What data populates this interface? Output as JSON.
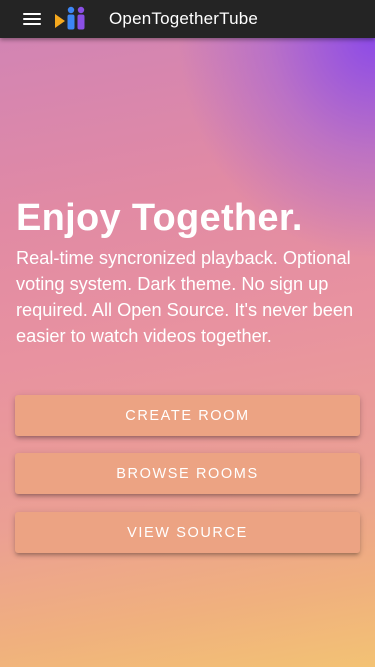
{
  "app_bar": {
    "title": "OpenTogetherTube",
    "menu_icon": "hamburger-menu-icon",
    "logo_icon": "opentogethertube-logo"
  },
  "hero": {
    "title": "Enjoy Together.",
    "subtitle": "Real-time syncronized playback. Optional voting system. Dark theme. No sign up required. All Open Source. It's never been easier to watch videos together."
  },
  "actions": {
    "create_room": "CREATE ROOM",
    "browse_rooms": "BROWSE ROOMS",
    "view_source": "VIEW SOURCE"
  },
  "colors": {
    "app_bar_bg": "#242424",
    "button_bg": "#eca383",
    "gradient_top_right": "#8746eb",
    "gradient_mid": "#e18aa4",
    "gradient_bottom_left": "#f3c274",
    "logo_orange": "#f6a91e",
    "logo_blue": "#3d86f5",
    "logo_purple": "#8a4fe6"
  }
}
